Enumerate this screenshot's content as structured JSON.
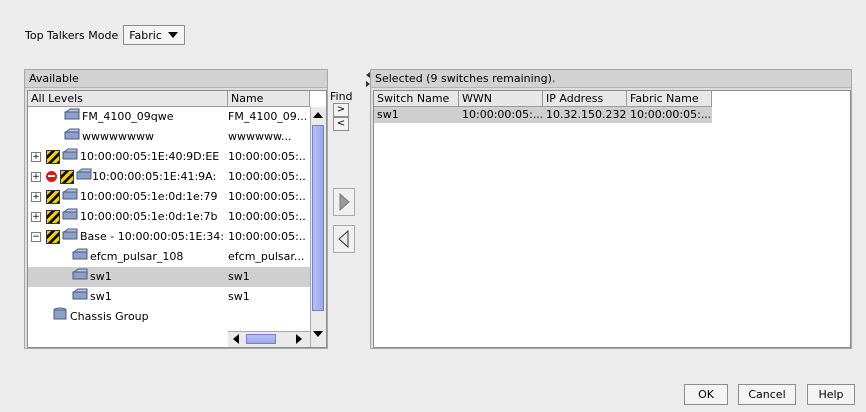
{
  "mode": {
    "label": "Top Talkers Mode",
    "value": "Fabric"
  },
  "available": {
    "title": "Available",
    "columns": [
      "All Levels",
      "Name"
    ],
    "rows": [
      {
        "label": "FM_4100_09qwe",
        "name": "FM_4100_09..."
      },
      {
        "label": "wwwwwwww",
        "name": "wwwwww..."
      },
      {
        "label": "10:00:00:05:1E:40:9D:EE",
        "name": "10:00:00:05:..."
      },
      {
        "label": "10:00:00:05:1E:41:9A:",
        "name": "10:00:00:05:..."
      },
      {
        "label": "10:00:00:05:1e:0d:1e:79",
        "name": "10:00:00:05:..."
      },
      {
        "label": "10:00:00:05:1e:0d:1e:7b",
        "name": "10:00:00:05:..."
      },
      {
        "label": "Base - 10:00:00:05:1E:34:",
        "name": "10:00:00:05:..."
      },
      {
        "label": "efcm_pulsar_108",
        "name": "efcm_pulsar..."
      },
      {
        "label": "sw1",
        "name": "sw1"
      },
      {
        "label": "sw1",
        "name": "sw1"
      },
      {
        "label": "Chassis Group",
        "name": ""
      }
    ]
  },
  "find": {
    "label": "Find",
    "next": ">",
    "prev": "<"
  },
  "selected": {
    "title": "Selected (9 switches remaining).",
    "columns": [
      "Switch Name",
      "WWN",
      "IP Address",
      "Fabric Name"
    ],
    "rows": [
      {
        "switch_name": "sw1",
        "wwn": "10:00:00:05:...",
        "ip": "10.32.150.232",
        "fabric": "10:00:00:05:..."
      }
    ]
  },
  "buttons": {
    "ok": "OK",
    "cancel": "Cancel",
    "help": "Help"
  },
  "colors": {
    "selection": "#cfcfcf",
    "scroll_thumb": "#9ba7ee",
    "warning": "#f3d000"
  }
}
